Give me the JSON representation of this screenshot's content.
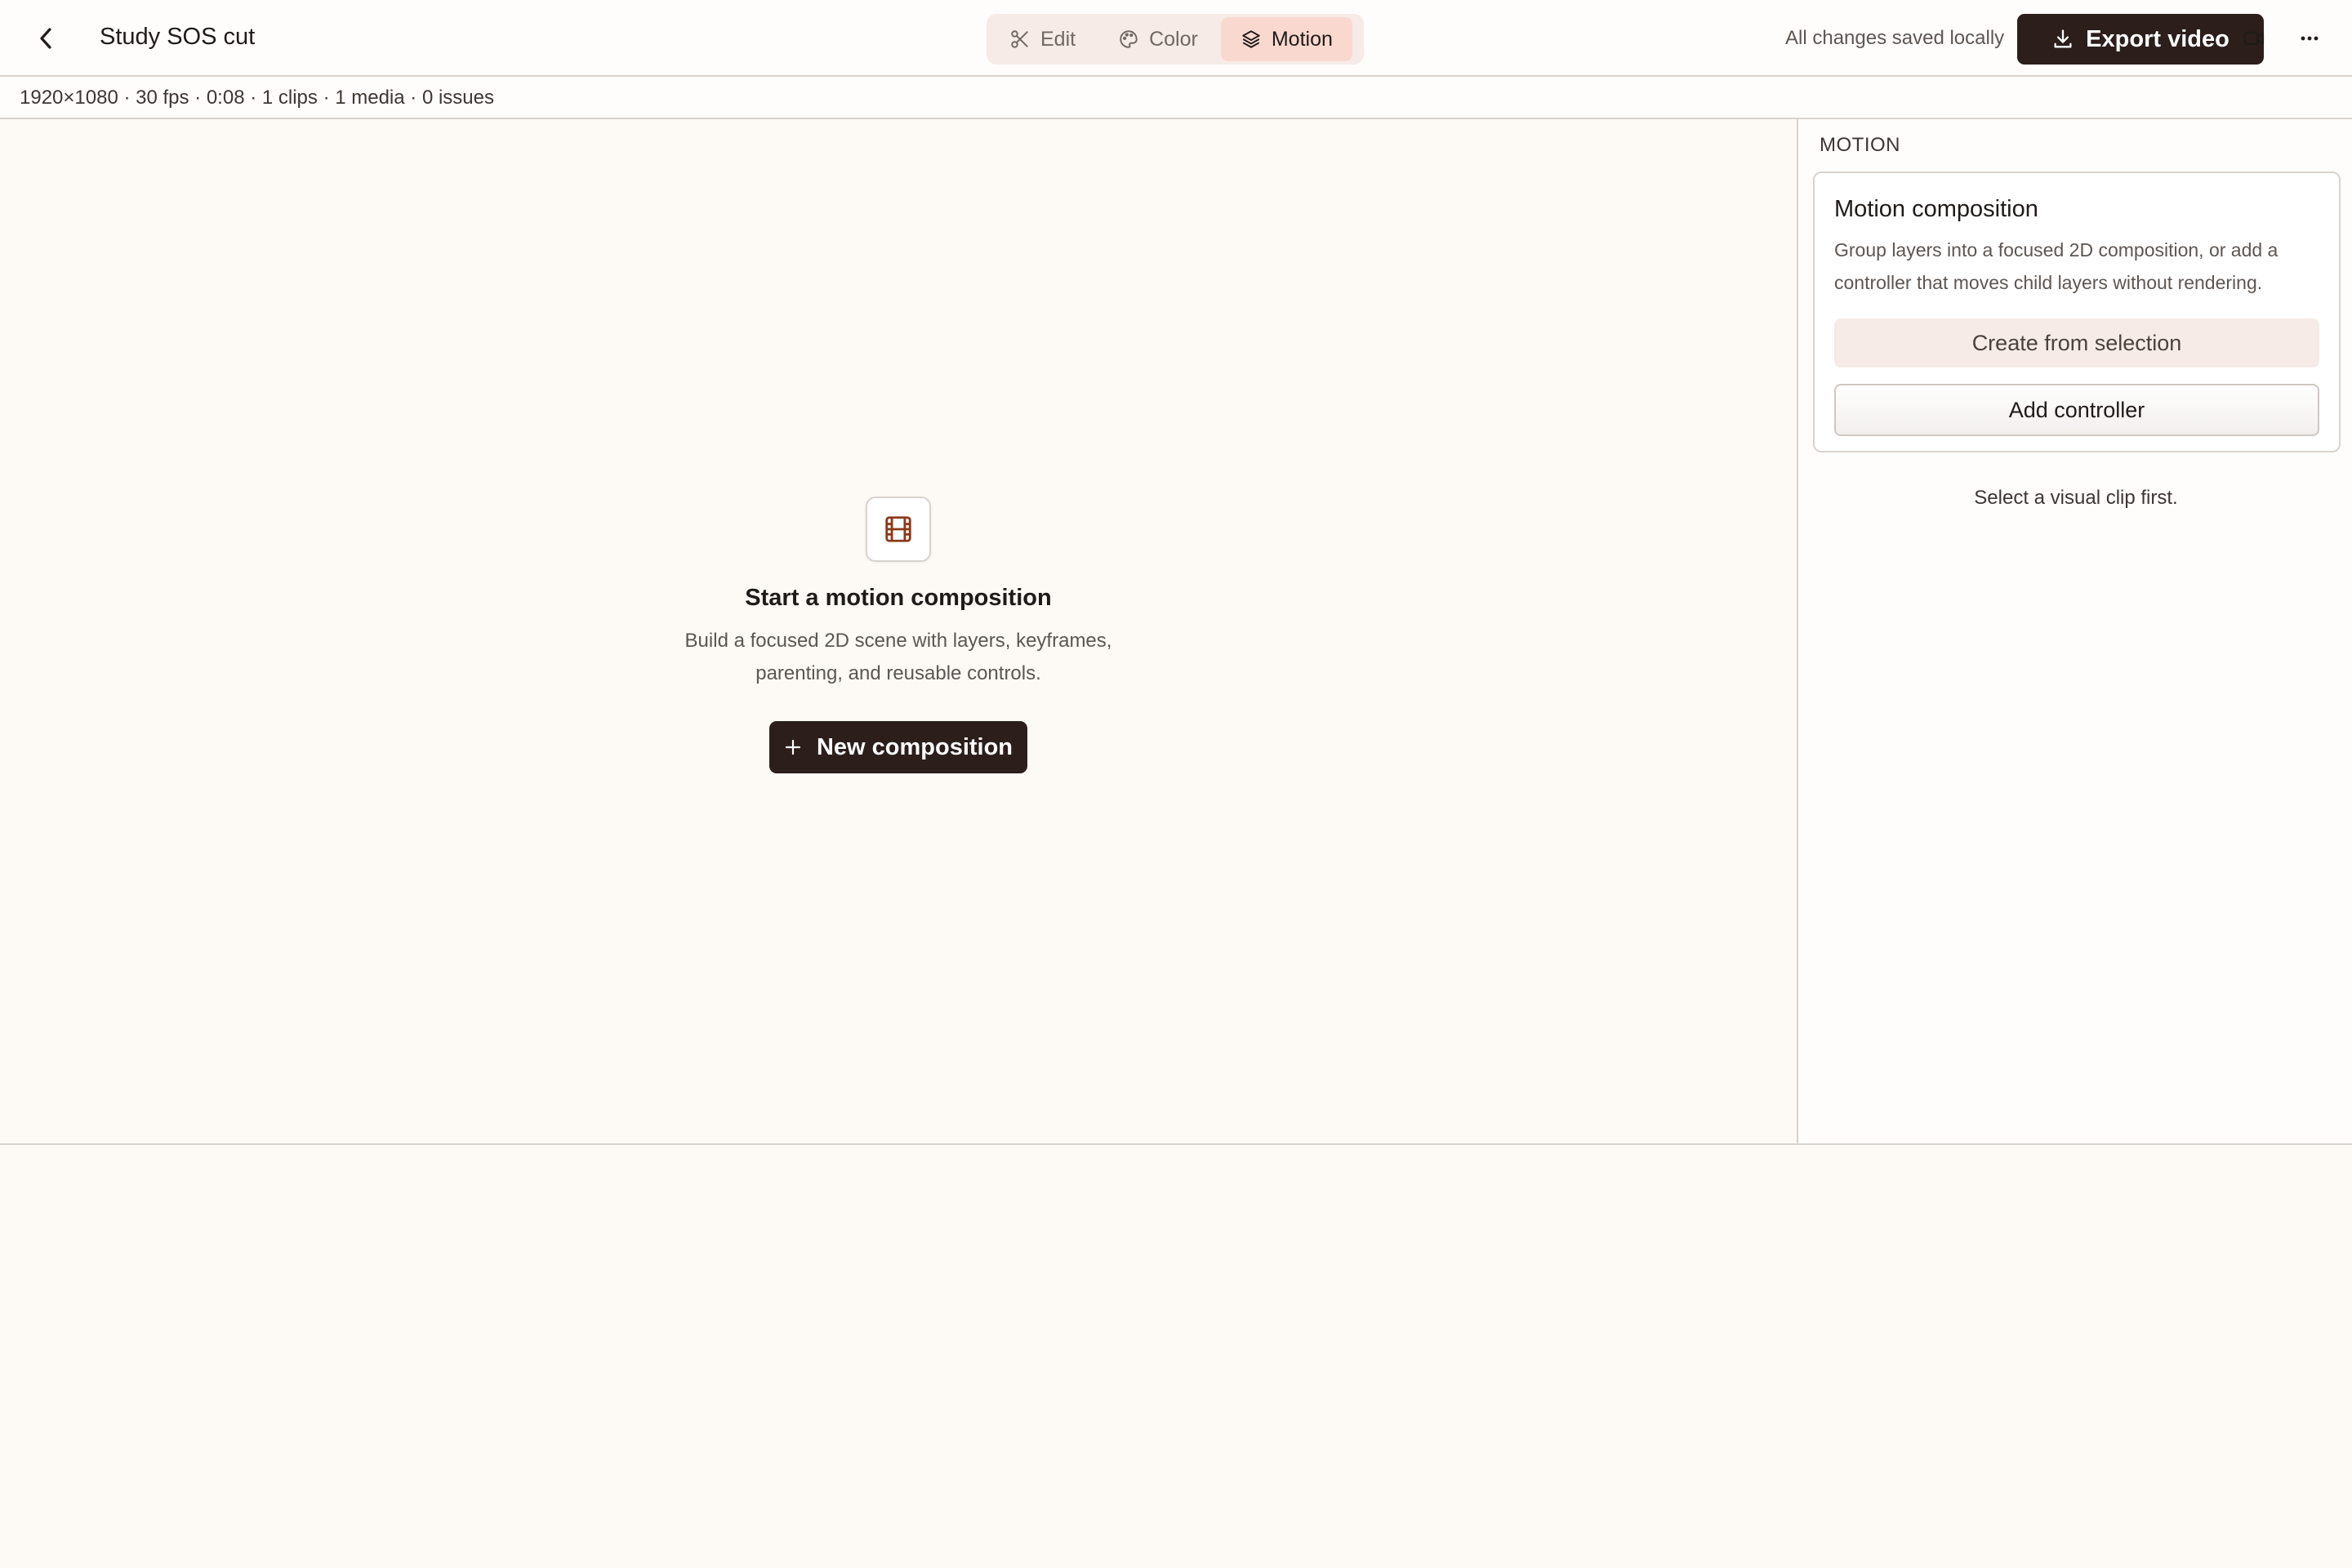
{
  "header": {
    "project_title": "Study SOS cut",
    "modes": [
      {
        "label": "Edit",
        "icon": "scissors-icon",
        "active": false
      },
      {
        "label": "Color",
        "icon": "palette-icon",
        "active": false
      },
      {
        "label": "Motion",
        "icon": "layers-icon",
        "active": true
      }
    ],
    "saved_status": "All changes saved locally",
    "export_label": "Export video"
  },
  "info_bar": {
    "project_meta": "1920×1080 · 30 fps · 0:08 · 1 clips · 1 media · 0 issues"
  },
  "canvas": {
    "empty_state": {
      "icon": "film-icon",
      "title": "Start a motion composition",
      "description": "Build a focused 2D scene with layers, keyframes, parenting, and reusable controls.",
      "button_label": "New composition"
    }
  },
  "panel": {
    "heading": "MOTION",
    "card": {
      "title": "Motion composition",
      "description": "Group layers into a focused 2D composition, or add a controller that moves child layers without rendering.",
      "primary_label": "Create from selection",
      "secondary_label": "Add controller"
    },
    "hint": "Select a visual clip first."
  },
  "colors": {
    "accent": "#8b3a1a",
    "dark_button": "#2b1e1b",
    "active_tab": "#f9d9cf",
    "background": "#fdf9f5"
  }
}
